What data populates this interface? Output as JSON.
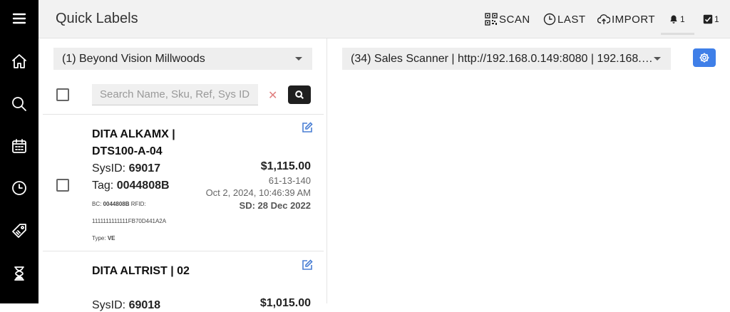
{
  "app": {
    "title": "Quick Labels"
  },
  "sidebar": {
    "items": [
      {
        "name": "menu",
        "icon": "hamburger-icon"
      },
      {
        "name": "home",
        "icon": "home-icon"
      },
      {
        "name": "search",
        "icon": "search-icon"
      },
      {
        "name": "calendar",
        "icon": "calendar-icon"
      },
      {
        "name": "history",
        "icon": "clock-icon"
      },
      {
        "name": "labels",
        "icon": "tag-icon"
      },
      {
        "name": "pending",
        "icon": "hourglass-icon"
      }
    ]
  },
  "toolbar": {
    "scan_label": "SCAN",
    "last_label": "LAST",
    "import_label": "IMPORT",
    "notifications_count": "1",
    "tasks_count": "1"
  },
  "left": {
    "store_select": "(1) Beyond Vision Millwoods",
    "search_placeholder": "Search Name, Sku, Ref, Sys ID",
    "clear_symbol": "✕"
  },
  "right": {
    "scanner_select": "(34) Sales Scanner | http://192.168.0.149:8080 | 192.168.…"
  },
  "items": [
    {
      "name": "DITA ALKAMX | DTS100-A-04",
      "sysid_label": "SysID:",
      "sysid": "69017",
      "tag_label": "Tag:",
      "tag": "0044808B",
      "bc_label": "BC:",
      "bc": "0044808B",
      "rfid_label": "RFID:",
      "rfid": "1111111111111FB70D441A2A",
      "type_label": "Type:",
      "type": "VE",
      "price": "$1,115.00",
      "ref": "61-13-140",
      "datetime": "Oct 2, 2024, 10:46:39 AM",
      "sd": "SD: 28 Dec 2022"
    },
    {
      "name": "DITA ALTRIST | 02",
      "sysid_label": "SysID:",
      "sysid": "69018",
      "price": "$1,015.00"
    }
  ],
  "colors": {
    "sidebar": "#000000",
    "topbar": "#f2f2f2",
    "accent": "#3f7fe8",
    "edit": "#4a7fd4",
    "clear": "#e08080"
  }
}
